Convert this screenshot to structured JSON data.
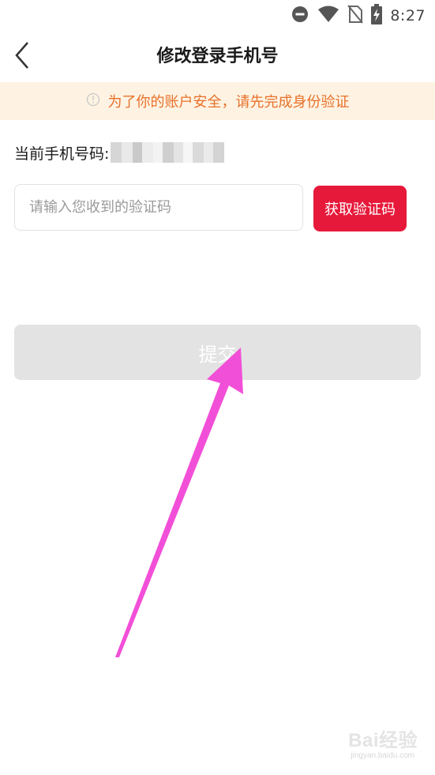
{
  "status_bar": {
    "time": "8:27",
    "icons": [
      "do-not-disturb-icon",
      "wifi-icon",
      "no-sim-icon",
      "battery-charging-icon"
    ]
  },
  "header": {
    "title": "修改登录手机号",
    "back_icon": "chevron-left-icon"
  },
  "notice": {
    "icon": "info-circle-icon",
    "text": "为了你的账户安全，请先完成身份验证"
  },
  "current_phone": {
    "label": "当前手机号码:"
  },
  "verification": {
    "placeholder": "请输入您收到的验证码",
    "value": "",
    "get_code_label": "获取验证码"
  },
  "submit": {
    "label": "提交"
  },
  "watermark": {
    "main": "Bai经验",
    "sub": "jingyan.baidu.com"
  },
  "colors": {
    "accent": "#e6193a",
    "notice_bg": "#fef3e3",
    "notice_text": "#e8712a",
    "submit_disabled": "#e3e3e3",
    "annotation_arrow": "#f24fd8"
  }
}
